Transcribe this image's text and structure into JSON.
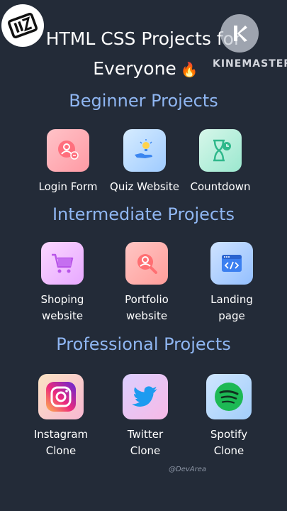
{
  "header": {
    "title_line1": "HTML CSS Projects for",
    "title_line2": "Everyone",
    "flame_emoji": "🔥",
    "brand": "KINEMASTER"
  },
  "sections": [
    {
      "title": "Beginner Projects",
      "items": [
        {
          "label": "Login Form",
          "icon": "user-badge-icon"
        },
        {
          "label": "Quiz Website",
          "icon": "lightbulb-hand-icon"
        },
        {
          "label": "Countdown",
          "icon": "hourglass-clock-icon"
        }
      ]
    },
    {
      "title": "Intermediate Projects",
      "items": [
        {
          "label": "Shoping website",
          "icon": "cart-icon"
        },
        {
          "label": "Portfolio website",
          "icon": "profile-search-icon"
        },
        {
          "label": "Landing page",
          "icon": "code-window-icon"
        }
      ]
    },
    {
      "title": "Professional Projects",
      "items": [
        {
          "label": "Instagram Clone",
          "icon": "instagram-icon"
        },
        {
          "label": "Twitter Clone",
          "icon": "twitter-icon"
        },
        {
          "label": "Spotify Clone",
          "icon": "spotify-icon"
        }
      ]
    }
  ],
  "watermark": "@DevArea",
  "colors": {
    "background": "#232b38",
    "section_title": "#8fb6f2",
    "text": "#ffffff"
  }
}
